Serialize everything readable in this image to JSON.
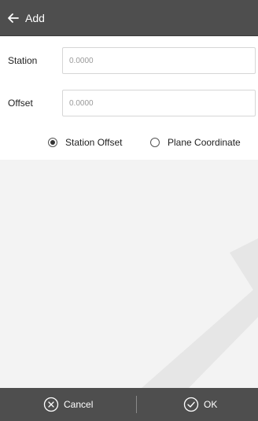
{
  "header": {
    "back_icon": "arrow-left-icon",
    "title": "Add"
  },
  "form": {
    "station": {
      "label": "Station",
      "value": "0.0000"
    },
    "offset": {
      "label": "Offset",
      "value": "0.0000"
    },
    "mode_options": [
      {
        "label": "Station Offset",
        "selected": true
      },
      {
        "label": "Plane Coordinate",
        "selected": false
      }
    ]
  },
  "footer": {
    "cancel": {
      "label": "Cancel",
      "icon": "circle-x-icon"
    },
    "ok": {
      "label": "OK",
      "icon": "circle-check-icon"
    }
  }
}
